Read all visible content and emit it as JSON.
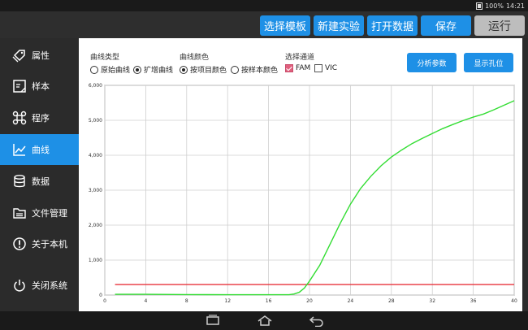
{
  "status": {
    "battery": "100%",
    "time": "14:21"
  },
  "toolbar": {
    "select_template": "选择模板",
    "new_experiment": "新建实验",
    "open_data": "打开数据",
    "save": "保存",
    "run": "运行"
  },
  "sidebar": {
    "items": [
      {
        "label": "属性",
        "icon": "tag-icon"
      },
      {
        "label": "样本",
        "icon": "sample-icon"
      },
      {
        "label": "程序",
        "icon": "program-icon"
      },
      {
        "label": "曲线",
        "icon": "curve-icon"
      },
      {
        "label": "数据",
        "icon": "database-icon"
      },
      {
        "label": "文件管理",
        "icon": "folder-icon"
      },
      {
        "label": "关于本机",
        "icon": "info-icon"
      },
      {
        "label": "关闭系统",
        "icon": "power-icon"
      }
    ],
    "active": "曲线"
  },
  "options": {
    "curve_type": {
      "title": "曲线类型",
      "raw": "原始曲线",
      "amplified": "扩增曲线",
      "selected": "扩增曲线"
    },
    "curve_color": {
      "title": "曲线颜色",
      "by_item": "按项目颜色",
      "by_sample": "按样本颜色",
      "selected": "按项目颜色"
    },
    "channel": {
      "title": "选择通道",
      "fam": "FAM",
      "vic": "VIC",
      "fam_checked": true,
      "vic_checked": false
    }
  },
  "actions": {
    "analysis_params": "分析参数",
    "show_wells": "显示孔位"
  },
  "colors": {
    "accent": "#1e90e6",
    "threshold": "#e8333c",
    "curve": "#33dd33"
  },
  "chart_data": {
    "type": "line",
    "title": "",
    "xlabel": "",
    "ylabel": "",
    "xlim": [
      0,
      40
    ],
    "ylim": [
      0,
      6000
    ],
    "xticks": [
      0,
      4,
      8,
      12,
      16,
      20,
      24,
      28,
      32,
      36,
      40
    ],
    "yticks": [
      0,
      1000,
      2000,
      3000,
      4000,
      5000,
      6000
    ],
    "ytick_labels": [
      "0",
      "1,000",
      "2,000",
      "3,000",
      "4,000",
      "5,000",
      "6,000"
    ],
    "grid": true,
    "series": [
      {
        "color": "#e8333c",
        "x": [
          1,
          40
        ],
        "y": [
          300,
          300
        ]
      },
      {
        "color": "#33dd33",
        "x": [
          1,
          4,
          8,
          12,
          16,
          18,
          18.5,
          19,
          19.5,
          20,
          21,
          22,
          23,
          24,
          25,
          26,
          27,
          28,
          29,
          30,
          31,
          32,
          33,
          34,
          35,
          36,
          37,
          38,
          39,
          40
        ],
        "y": [
          20,
          20,
          15,
          10,
          10,
          10,
          30,
          80,
          200,
          400,
          850,
          1450,
          2050,
          2600,
          3050,
          3400,
          3700,
          3950,
          4150,
          4330,
          4480,
          4620,
          4760,
          4880,
          4990,
          5090,
          5180,
          5300,
          5430,
          5560
        ]
      }
    ]
  }
}
